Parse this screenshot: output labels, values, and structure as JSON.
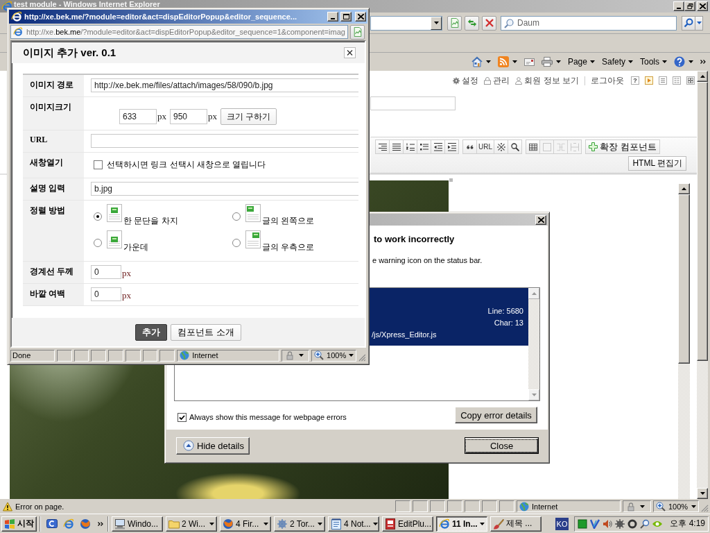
{
  "browser": {
    "title": "test module - Windows Internet Explorer",
    "search": {
      "placeholder": "Daum"
    },
    "command_menus": [
      "Page",
      "Safety",
      "Tools"
    ],
    "user_links": [
      {
        "label": "설정",
        "kind": "settings"
      },
      {
        "label": "관리",
        "kind": "admin"
      },
      {
        "label": "회원 정보 보기",
        "kind": "profile"
      },
      {
        "label": "로그아웃",
        "kind": "logout"
      }
    ],
    "help_button": "?",
    "editor": {
      "url_button": "URL",
      "table_tools": [
        {
          "kind": "table",
          "disabled": false
        },
        {
          "kind": "cell",
          "disabled": true
        },
        {
          "kind": "merge",
          "disabled": true
        },
        {
          "kind": "split",
          "disabled": true
        }
      ],
      "component_button": "확장 컴포넌트",
      "html_button": "HTML 편집기"
    },
    "status_bar": {
      "message": "Error on page.",
      "zone": "Internet",
      "zoom": "100%"
    }
  },
  "popup": {
    "title": "http://xe.bek.me/?module=editor&act=dispEditorPopup&editor_sequence...",
    "address": {
      "prefix": "http://xe.",
      "domain": "bek.me",
      "rest": "/?module=editor&act=dispEditorPopup&editor_sequence=1&component=imag"
    },
    "dialog": {
      "title": "이미지 추가 ver. 0.1",
      "rows": [
        {
          "label": "이미지 경로",
          "kind": "text",
          "value": "http://xe.bek.me/files/attach/images/58/090/b.jpg"
        },
        {
          "label": "이미지크기",
          "kind": "size",
          "fields": [
            {
              "value": "633",
              "unit": "px"
            },
            {
              "value": "950",
              "unit": "px"
            }
          ],
          "button": "크기 구하기"
        },
        {
          "label": "URL",
          "kind": "text"
        },
        {
          "label": "새창열기",
          "kind": "checkbox",
          "checked": false,
          "text": "선택하시면 링크 선택시 새창으로 열립니다"
        },
        {
          "label": "설명 입력",
          "kind": "text",
          "value": "b.jpg"
        },
        {
          "label": "정렬 방법",
          "kind": "align",
          "options": [
            {
              "label": "한 문단을 차지",
              "kind": "block",
              "selected": true
            },
            {
              "label": "글의 왼쪽으로",
              "kind": "left",
              "selected": false
            },
            {
              "label": "가운데",
              "kind": "center",
              "selected": false
            },
            {
              "label": "글의 우측으로",
              "kind": "right",
              "selected": false
            }
          ]
        },
        {
          "label": "경계선 두께",
          "kind": "number",
          "value": "0",
          "unit": "px"
        },
        {
          "label": "바깥 여백",
          "kind": "number",
          "value": "0",
          "unit": "px"
        }
      ],
      "buttons": [
        {
          "label": "추가",
          "kind": "primary"
        },
        {
          "label": "컴포넌트 소개",
          "kind": "secondary"
        }
      ]
    },
    "status_bar": {
      "message": "Done",
      "zone": "Internet",
      "zoom": "100%"
    }
  },
  "error_dialog": {
    "heading": "to work incorrectly",
    "message": "e warning icon on the status bar.",
    "details": {
      "line": "Line: 5680",
      "char": "Char: 13",
      "file": "/js/Xpress_Editor.js"
    },
    "always_show": {
      "label": "Always show this message for webpage errors",
      "checked": true
    },
    "copy_button": "Copy error details",
    "details_button": "Hide details",
    "close_button": "Close"
  },
  "taskbar": {
    "start": "시작",
    "tasks": [
      {
        "label": "Windo...",
        "kind": "console",
        "grouped": false,
        "selected": false
      },
      {
        "label": "2 Wi...",
        "kind": "folder",
        "grouped": true,
        "selected": false
      },
      {
        "label": "4 Fir...",
        "kind": "fox",
        "grouped": true,
        "selected": false
      },
      {
        "label": "2 Tor...",
        "kind": "torrent",
        "grouped": true,
        "selected": false
      },
      {
        "label": "4 Not...",
        "kind": "notepad",
        "grouped": true,
        "selected": false
      },
      {
        "label": "EditPlu...",
        "kind": "editor",
        "grouped": false,
        "selected": false
      },
      {
        "label": "11 In...",
        "kind": "browser",
        "grouped": true,
        "selected": true
      },
      {
        "label": "제목 ...",
        "kind": "paint",
        "grouped": false,
        "selected": false
      }
    ],
    "language": "KO",
    "clock": "오후 4:19"
  }
}
